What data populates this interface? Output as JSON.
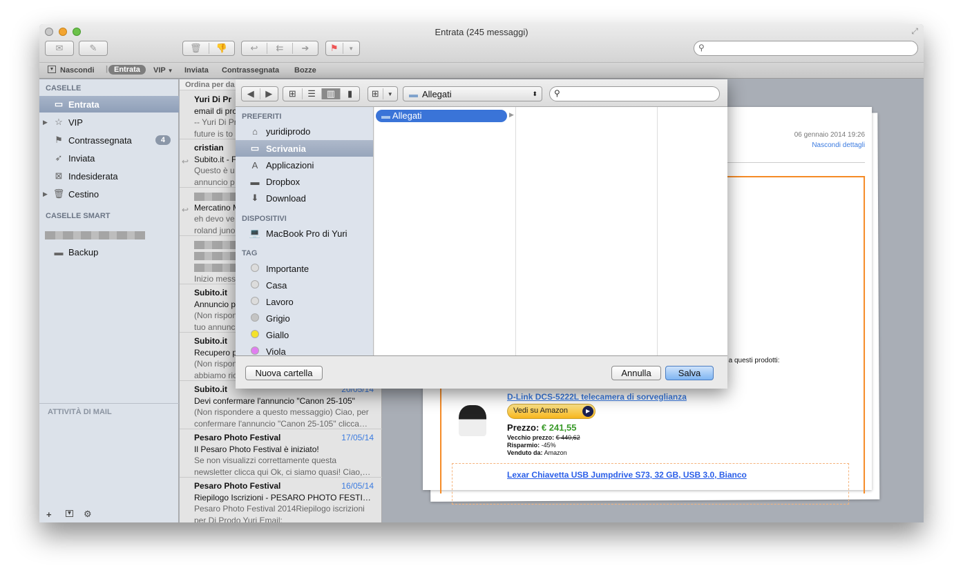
{
  "window": {
    "title": "Entrata (245 messaggi)"
  },
  "toolbar": {
    "icons": [
      "envelope-icon",
      "compose-icon",
      "trash-icon",
      "junk-icon",
      "reply-icon",
      "reply-all-icon",
      "forward-icon",
      "flag-icon"
    ],
    "search_placeholder": ""
  },
  "favbar": {
    "hide": "Nascondi",
    "items": [
      "Entrata",
      "VIP",
      "Inviata",
      "Contrassegnata",
      "Bozze"
    ]
  },
  "sidebar": {
    "header": "CASELLE",
    "items": [
      {
        "label": "Entrata"
      },
      {
        "label": "VIP"
      },
      {
        "label": "Contrassegnata",
        "badge": "4"
      },
      {
        "label": "Inviata"
      },
      {
        "label": "Indesiderata"
      },
      {
        "label": "Cestino"
      }
    ],
    "smart_header": "CASELLE SMART",
    "smart_items": [
      {
        "label": "Backup"
      }
    ],
    "activity": "ATTIVITÀ DI MAIL"
  },
  "list": {
    "sort": "Ordina per da",
    "messages": [
      {
        "from": "Yuri Di Pr",
        "date": "",
        "subject": "email di pro",
        "preview1": "-- Yuri Di Pr",
        "preview2": "future is to"
      },
      {
        "from": "cristian",
        "date": "",
        "subject": "Subito.it - F",
        "preview1": "Questo è u",
        "preview2": "annuncio p"
      },
      {
        "from": "",
        "date": "",
        "subject": "Mercatino M",
        "preview1": "eh devo ve",
        "preview2": "roland juno"
      },
      {
        "from": "",
        "date": "",
        "subject": "",
        "preview1": "",
        "preview2": "Inizio mess"
      },
      {
        "from": "Subito.it",
        "date": "",
        "subject": "Annuncio p",
        "preview1": "(Non rispon",
        "preview2": "tuo annunc"
      },
      {
        "from": "Subito.it",
        "date": "",
        "subject": "Recupero p",
        "preview1": "(Non rispon",
        "preview2": "abbiamo ric"
      },
      {
        "from": "Subito.it",
        "date": "20/05/14",
        "subject": "Devi confermare l'annuncio \"Canon 25-105\"",
        "preview1": "(Non rispondere a questo messaggio) Ciao, per",
        "preview2": "confermare l'annuncio \"Canon 25-105\" clicca…"
      },
      {
        "from": "Pesaro Photo Festival",
        "date": "17/05/14",
        "subject": "Il Pesaro Photo Festival è iniziato!",
        "preview1": "Se non visualizzi correttamente questa",
        "preview2": "newsletter clicca qui Ok, ci siamo quasi! Ciao,…"
      },
      {
        "from": "Pesaro Photo Festival",
        "date": "16/05/14",
        "subject": "Riepilogo Iscrizioni - PESARO PHOTO FESTI…",
        "preview1": "Pesaro Photo Festival 2014Riepilogo iscrizioni",
        "preview2": "per Di Prodo Yuri Email:"
      }
    ]
  },
  "message": {
    "date": "06 gennaio 2014 19:26",
    "hide_details": "Nascondi dettagli",
    "interest": "ressato a questi prodotti:",
    "product1": "D-Link DCS-5222L telecamera di sorveglianza",
    "amazon_button": "Vedi su Amazon",
    "price_label": "Prezzo:",
    "price": "€ 241,55",
    "old_price_label": "Vecchio prezzo:",
    "old_price": "€ 440,62",
    "savings_label": "Risparmio:",
    "savings": "-45%",
    "seller_label": "Venduto da:",
    "seller": "Amazon",
    "product2": "Lexar Chiavetta USB Jumpdrive S73, 32 GB, USB 3.0, Bianco"
  },
  "dialog": {
    "location": "Allegati",
    "search_placeholder": "",
    "favorites_header": "PREFERITI",
    "favorites": [
      {
        "label": "yuridiprodo",
        "icon": "home-icon"
      },
      {
        "label": "Scrivania",
        "icon": "desktop-icon"
      },
      {
        "label": "Applicazioni",
        "icon": "applications-icon"
      },
      {
        "label": "Dropbox",
        "icon": "folder-icon"
      },
      {
        "label": "Download",
        "icon": "download-icon"
      }
    ],
    "devices_header": "DISPOSITIVI",
    "devices": [
      {
        "label": "MacBook Pro di Yuri"
      }
    ],
    "tags_header": "TAG",
    "tags": [
      {
        "label": "Importante",
        "color": "#dcdcdc"
      },
      {
        "label": "Casa",
        "color": "#dcdcdc"
      },
      {
        "label": "Lavoro",
        "color": "#dcdcdc"
      },
      {
        "label": "Grigio",
        "color": "#c4c4c4"
      },
      {
        "label": "Giallo",
        "color": "#f4e22a"
      },
      {
        "label": "Viola",
        "color": "#e07ef0"
      }
    ],
    "column_item": "Allegati",
    "new_folder": "Nuova cartella",
    "cancel": "Annulla",
    "save": "Salva"
  }
}
